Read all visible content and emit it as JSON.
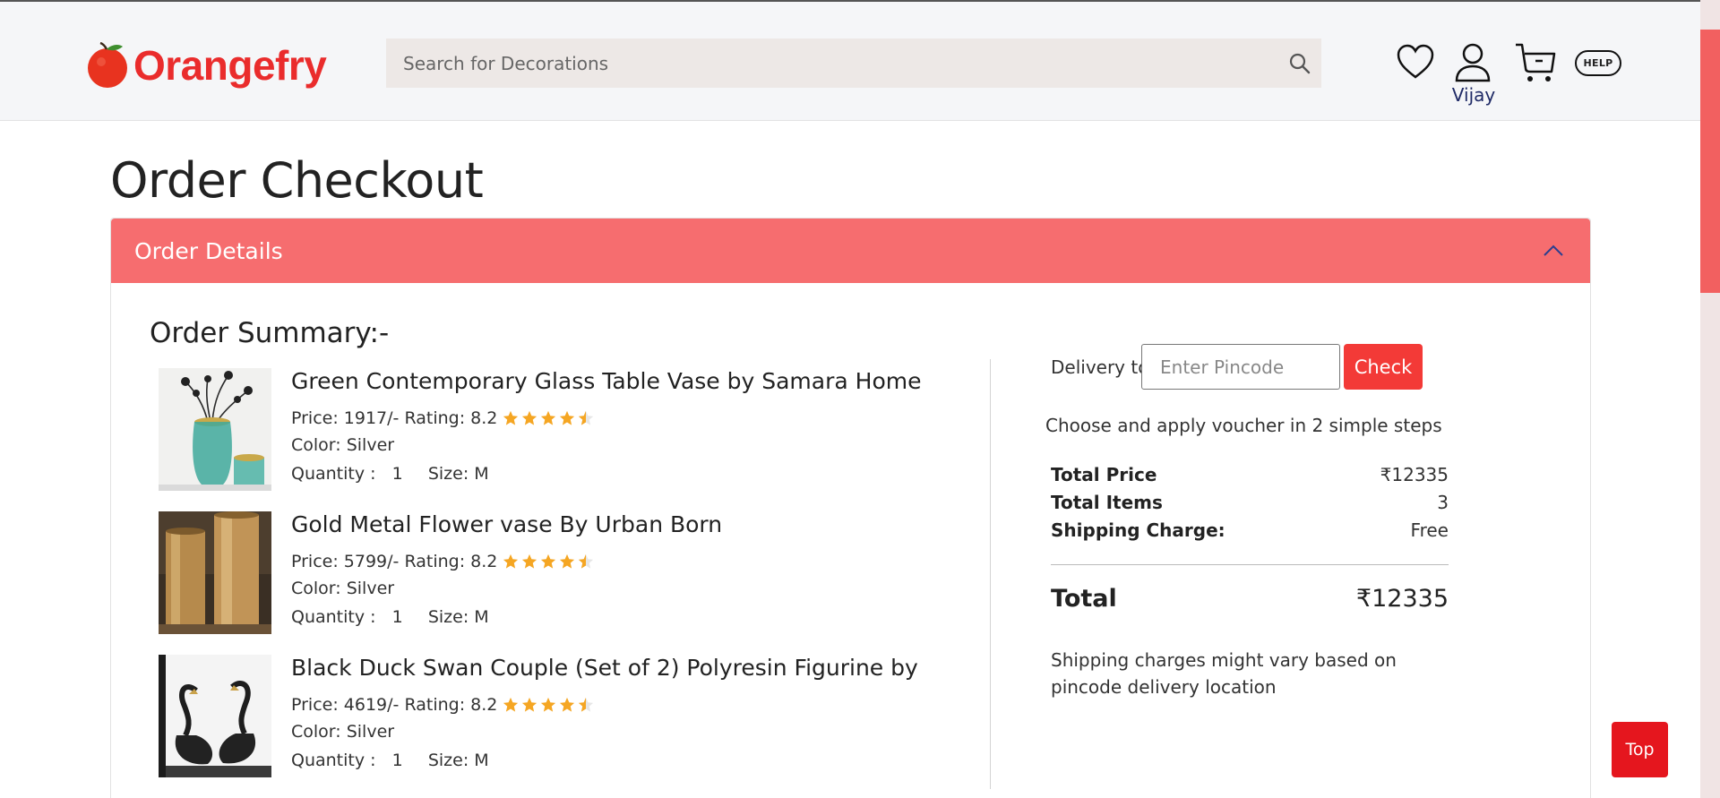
{
  "header": {
    "brand": "Orangefry",
    "search_placeholder": "Search for Decorations",
    "account_name": "Vijay",
    "help_label": "HELP"
  },
  "page": {
    "title": "Order Checkout"
  },
  "order_panel": {
    "title": "Order Details",
    "summary_title": "Order Summary:-"
  },
  "items": [
    {
      "name": "Green Contemporary Glass Table Vase by Samara Home",
      "price_line": "Price: 1917/- Rating: 8.2",
      "rating_stars": 4.5,
      "color": "Color: Silver",
      "quantity": "Quantity :   1",
      "size": "Size: M"
    },
    {
      "name": "Gold Metal Flower vase By Urban Born",
      "price_line": "Price: 5799/- Rating: 8.2",
      "rating_stars": 4.5,
      "color": "Color: Silver",
      "quantity": "Quantity :   1",
      "size": "Size: M"
    },
    {
      "name": "Black Duck Swan Couple (Set of 2) Polyresin Figurine by",
      "price_line": "Price: 4619/- Rating: 8.2",
      "rating_stars": 4.5,
      "color": "Color: Silver",
      "quantity": "Quantity :   1",
      "size": "Size: M"
    }
  ],
  "delivery": {
    "label": "Delivery to",
    "pincode_placeholder": "Enter Pincode",
    "check_label": "Check"
  },
  "voucher_text": "Choose and apply voucher in 2 simple steps",
  "pricing": {
    "total_price_label": "Total Price",
    "total_price_value": "₹12335",
    "total_items_label": "Total Items",
    "total_items_value": "3",
    "shipping_label": "Shipping Charge:",
    "shipping_value": "Free",
    "total_label": "Total",
    "total_value": "₹12335"
  },
  "shipping_note": "Shipping charges might vary based on pincode delivery location",
  "top_button_label": "Top",
  "colors": {
    "brand_red": "#ea2c2c",
    "panel_header": "#f66d6f",
    "check_button": "#f33a37",
    "top_button": "#e5161e",
    "star": "#f5a623"
  }
}
